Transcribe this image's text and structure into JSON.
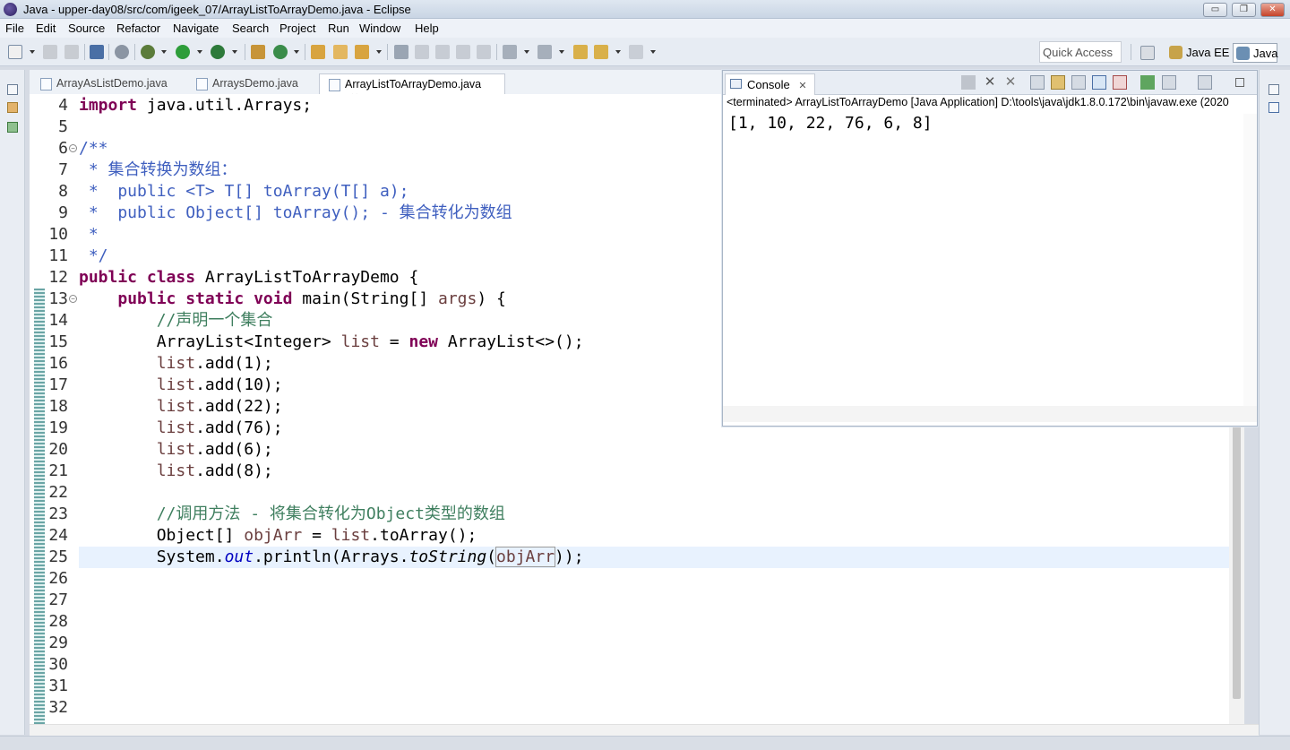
{
  "window": {
    "title": "Java - upper-day08/src/com/igeek_07/ArrayListToArrayDemo.java - Eclipse",
    "controls": {
      "minimize": "▭",
      "restore": "❐",
      "close": "✕"
    }
  },
  "menu": [
    "File",
    "Edit",
    "Source",
    "Refactor",
    "Navigate",
    "Search",
    "Project",
    "Run",
    "Window",
    "Help"
  ],
  "toolbar": {
    "quick_access_placeholder": "Quick Access",
    "perspectives": [
      "Java EE",
      "Java"
    ]
  },
  "editor": {
    "tabs": [
      {
        "label": "ArrayAsListDemo.java",
        "active": false
      },
      {
        "label": "ArraysDemo.java",
        "active": false
      },
      {
        "label": "ArrayListToArrayDemo.java",
        "active": true,
        "close": "✕"
      }
    ],
    "line_numbers": [
      "4",
      "5",
      "6",
      "7",
      "8",
      "9",
      "10",
      "11",
      "12",
      "13",
      "14",
      "15",
      "16",
      "17",
      "18",
      "19",
      "20",
      "21",
      "22",
      "23",
      "24",
      "25",
      "26",
      "27",
      "28",
      "29",
      "30",
      "31",
      "32"
    ],
    "lines": {
      "l4_kw": "import",
      "l4_rest": " java.util.Arrays;",
      "l6": "/**",
      "l7": " * 集合转换为数组：",
      "l8": " *  public <T> T[] toArray(T[] a);",
      "l9": " *  public Object[] toArray(); - 集合转化为数组",
      "l10": " *",
      "l11": " */",
      "l12_kw": "public class",
      "l12_rest": " ArrayListToArrayDemo {",
      "l13_indent": "    ",
      "l13_kw": "public static void",
      "l13_a": " main(String[] ",
      "l13_var": "args",
      "l13_b": ") {",
      "l14_indent": "        ",
      "l14_cm": "//声明一个集合",
      "l15_indent": "        ",
      "l15_a": "ArrayList<Integer> ",
      "l15_var": "list",
      "l15_b": " = ",
      "l15_kw": "new",
      "l15_c": " ArrayList<>();",
      "add_var": "list",
      "l16": ".add(1);",
      "l17": ".add(10);",
      "l18": ".add(22);",
      "l19": ".add(76);",
      "l20": ".add(6);",
      "l21": ".add(8);",
      "l23_cm": "//调用方法 - 将集合转化为Object类型的数组",
      "l24_a": "Object[] ",
      "l24_var": "objArr",
      "l24_b": " = ",
      "l24_var2": "list",
      "l24_c": ".toArray();",
      "l25_a": "System.",
      "l25_fld": "out",
      "l25_b": ".println(Arrays.",
      "l25_ita": "toString",
      "l25_c": "(",
      "l25_var": "objArr",
      "l25_d": "));"
    }
  },
  "console": {
    "tab_label": "Console",
    "tab_close": "✕",
    "status": "<terminated> ArrayListToArrayDemo [Java Application] D:\\tools\\java\\jdk1.8.0.172\\bin\\javaw.exe (2020",
    "output": "[1, 10, 22, 76, 6, 8]"
  }
}
